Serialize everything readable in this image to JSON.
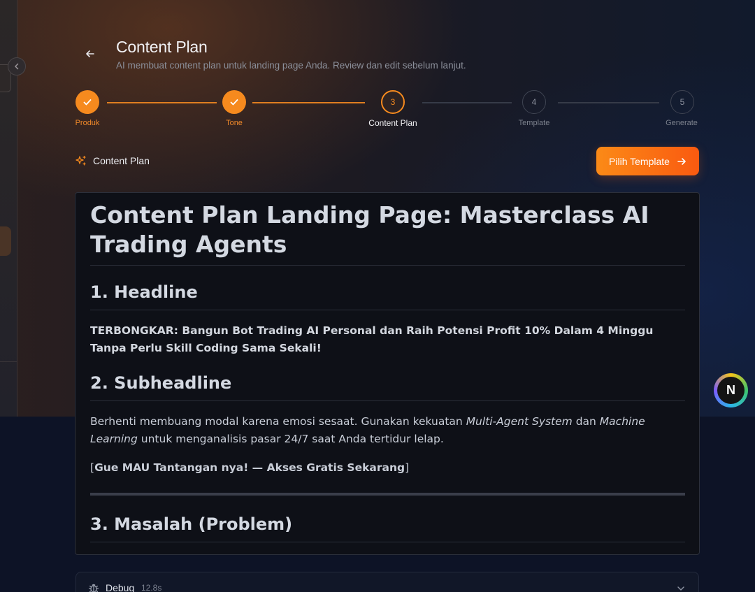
{
  "header": {
    "title": "Content Plan",
    "subtitle": "AI membuat content plan untuk landing page Anda. Review dan edit sebelum lanjut."
  },
  "stepper": {
    "steps": [
      {
        "number": "1",
        "label": "Produk",
        "state": "done"
      },
      {
        "number": "2",
        "label": "Tone",
        "state": "done"
      },
      {
        "number": "3",
        "label": "Content Plan",
        "state": "active"
      },
      {
        "number": "4",
        "label": "Template",
        "state": "todo"
      },
      {
        "number": "5",
        "label": "Generate",
        "state": "todo"
      }
    ]
  },
  "section": {
    "title": "Content Plan",
    "next_button": "Pilih Template"
  },
  "document": {
    "title": "Content Plan Landing Page: Masterclass AI Trading Agents",
    "headline_heading": "1. Headline",
    "headline_text": "TERBONGKAR: Bangun Bot Trading AI Personal dan Raih Potensi Profit 10% Dalam 4 Minggu Tanpa Perlu Skill Coding Sama Sekali!",
    "subheadline_heading": "2. Subheadline",
    "subheadline_text_1": "Berhenti membuang modal karena emosi sesaat. Gunakan kekuatan ",
    "subheadline_em_1": "Multi-Agent System",
    "subheadline_text_2": " dan ",
    "subheadline_em_2": "Machine Learning",
    "subheadline_text_3": " untuk menganalisis pasar 24/7 saat Anda tertidur lelap.",
    "cta_open": "[",
    "cta_text": "Gue MAU Tantangan nya! — Akses Gratis Sekarang",
    "cta_close": "]",
    "problem_heading": "3. Masalah (Problem)"
  },
  "debug": {
    "label": "Debug",
    "time": "12.8s"
  },
  "fab": {
    "letter": "N"
  },
  "colors": {
    "accent": "#f68a1e",
    "button_gradient_start": "#fb8a17",
    "button_gradient_end": "#fa5a10",
    "panel_bg": "#0e1017"
  }
}
